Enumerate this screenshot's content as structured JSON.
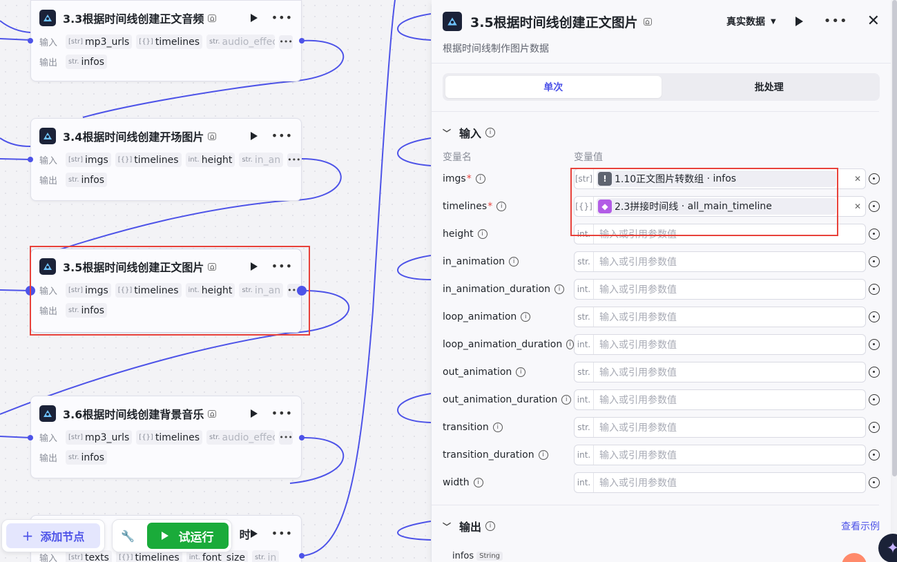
{
  "nodes": [
    {
      "title": "3.3根据时间线创建正文音频",
      "input_label": "输入",
      "output_label": "输出",
      "inputs": [
        {
          "type": "[str]",
          "name": "mp3_urls"
        },
        {
          "type": "[{}]",
          "name": "timelines"
        },
        {
          "type": "str.",
          "name": "audio_effect"
        }
      ],
      "outputs": [
        {
          "type": "str.",
          "name": "infos"
        }
      ]
    },
    {
      "title": "3.4根据时间线创建开场图片",
      "input_label": "输入",
      "output_label": "输出",
      "inputs": [
        {
          "type": "[str]",
          "name": "imgs"
        },
        {
          "type": "[{}]",
          "name": "timelines"
        },
        {
          "type": "int.",
          "name": "height"
        },
        {
          "type": "str.",
          "name": "in_an"
        }
      ],
      "outputs": [
        {
          "type": "str.",
          "name": "infos"
        }
      ]
    },
    {
      "title": "3.5根据时间线创建正文图片",
      "input_label": "输入",
      "output_label": "输出",
      "inputs": [
        {
          "type": "[str]",
          "name": "imgs"
        },
        {
          "type": "[{}]",
          "name": "timelines"
        },
        {
          "type": "int.",
          "name": "height"
        },
        {
          "type": "str.",
          "name": "in_an"
        }
      ],
      "outputs": [
        {
          "type": "str.",
          "name": "infos"
        }
      ]
    },
    {
      "title": "3.6根据时间线创建背景音乐",
      "input_label": "输入",
      "output_label": "输出",
      "inputs": [
        {
          "type": "[str]",
          "name": "mp3_urls"
        },
        {
          "type": "[{}]",
          "name": "timelines"
        },
        {
          "type": "str.",
          "name": "audio_effect"
        }
      ],
      "outputs": [
        {
          "type": "str.",
          "name": "infos"
        }
      ]
    },
    {
      "title": "时",
      "input_label": "输入",
      "inputs": [
        {
          "type": "[str]",
          "name": "texts"
        },
        {
          "type": "[{}]",
          "name": "timelines"
        },
        {
          "type": "int.",
          "name": "font_size"
        },
        {
          "type": "str.",
          "name": "in"
        }
      ]
    }
  ],
  "toolbar": {
    "add_node": "添加节点",
    "test_run": "试运行"
  },
  "panel": {
    "title": "3.5根据时间线创建正文图片",
    "description": "根据时间线制作图片数据",
    "data_mode": "真实数据",
    "tabs": [
      "单次",
      "批处理"
    ],
    "input_section": "输入",
    "col_name": "变量名",
    "col_value": "变量值",
    "placeholder": "输入或引用参数值",
    "params": [
      {
        "name": "imgs",
        "required": true,
        "type": "[str]",
        "ref": {
          "source": "1.10正文图片转数组",
          "field": "infos",
          "icon": "gray"
        }
      },
      {
        "name": "timelines",
        "required": true,
        "type": "[{}]",
        "ref": {
          "source": "2.3拼接时间线",
          "field": "all_main_timeline",
          "icon": "purple"
        }
      },
      {
        "name": "height",
        "required": false,
        "type": "int."
      },
      {
        "name": "in_animation",
        "required": false,
        "type": "str."
      },
      {
        "name": "in_animation_duration",
        "required": false,
        "type": "int."
      },
      {
        "name": "loop_animation",
        "required": false,
        "type": "str."
      },
      {
        "name": "loop_animation_duration",
        "required": false,
        "type": "int."
      },
      {
        "name": "out_animation",
        "required": false,
        "type": "str."
      },
      {
        "name": "out_animation_duration",
        "required": false,
        "type": "int."
      },
      {
        "name": "transition",
        "required": false,
        "type": "str."
      },
      {
        "name": "transition_duration",
        "required": false,
        "type": "int."
      },
      {
        "name": "width",
        "required": false,
        "type": "int."
      }
    ],
    "output_section": "输出",
    "view_example": "查看示例",
    "output_field": {
      "name": "infos",
      "type": "String"
    }
  },
  "colors": {
    "accent": "#4d53e8",
    "run_green": "#1aab3a",
    "highlight_red": "#e8413a"
  }
}
